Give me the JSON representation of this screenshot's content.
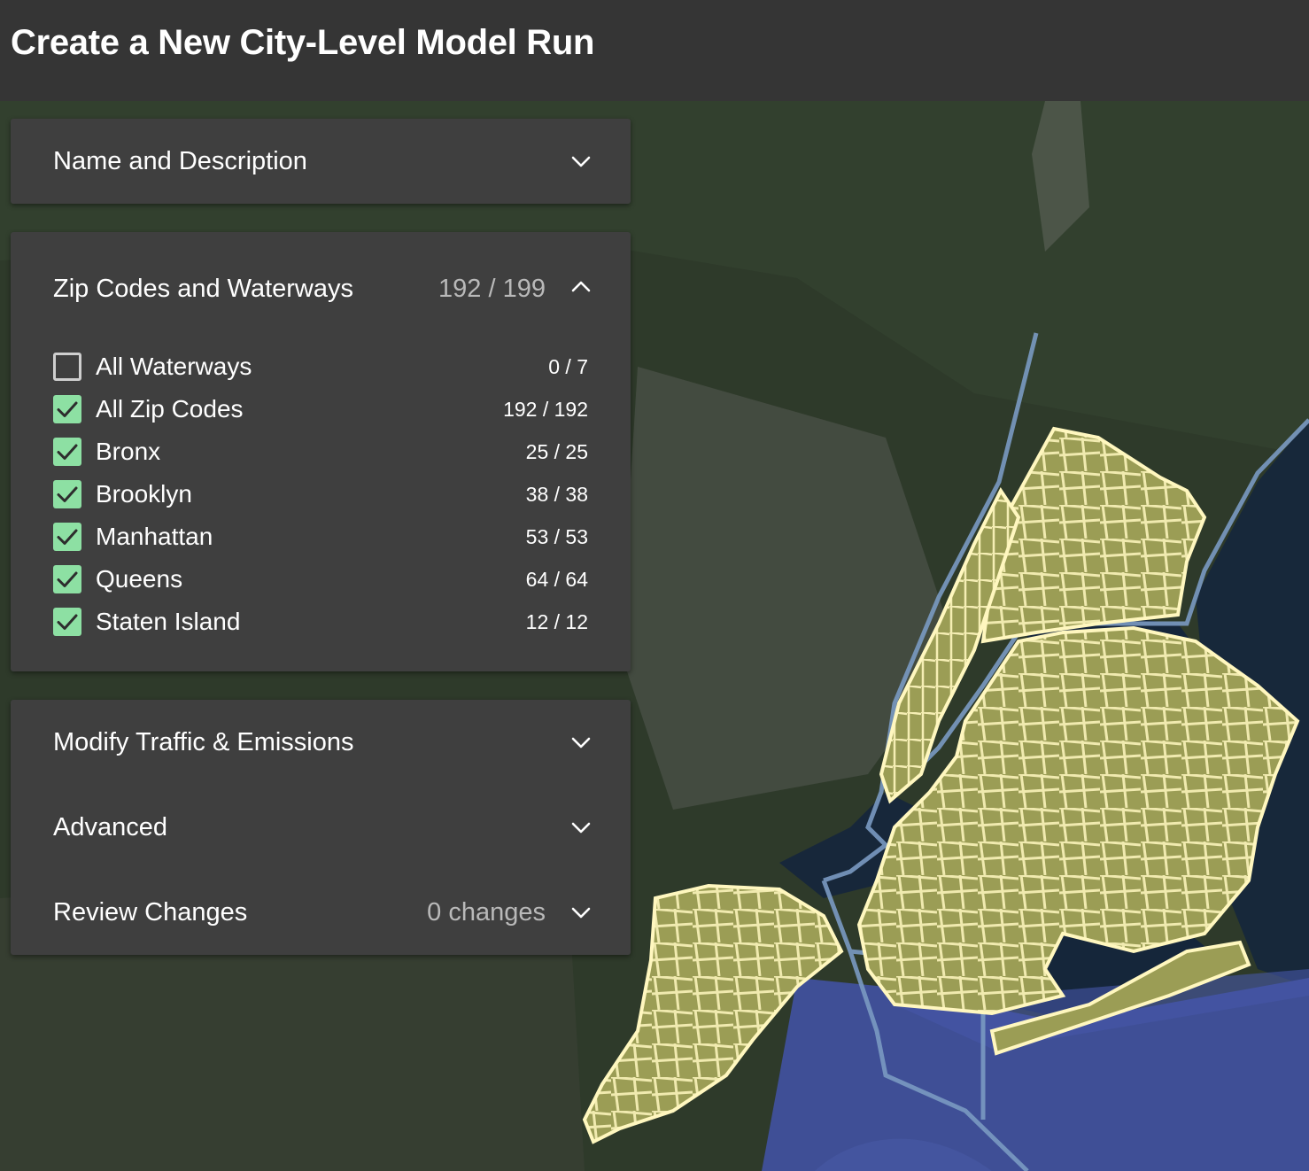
{
  "window": {
    "title": "Create a New City-Level Model Run"
  },
  "colors": {
    "title_bar": "#353535",
    "panel_background": "#3f3f3f",
    "checkbox_checked": "#8de0a3",
    "zip_polygon_fill": "#9b9d55",
    "zip_polygon_stroke": "#fff7bf",
    "waterway_stroke": "#7a9ac2"
  },
  "sections": {
    "name_description": {
      "title": "Name and Description",
      "expanded": false,
      "icon": "chevron-down-icon"
    },
    "zip_waterways": {
      "title": "Zip Codes and Waterways",
      "count": "192 / 199",
      "expanded": true,
      "icon": "chevron-up-icon",
      "items": [
        {
          "label": "All Waterways",
          "count": "0 / 7",
          "checked": false
        },
        {
          "label": "All Zip Codes",
          "count": "192 / 192",
          "checked": true
        },
        {
          "label": "Bronx",
          "count": "25 / 25",
          "checked": true
        },
        {
          "label": "Brooklyn",
          "count": "38 / 38",
          "checked": true
        },
        {
          "label": "Manhattan",
          "count": "53 / 53",
          "checked": true
        },
        {
          "label": "Queens",
          "count": "64 / 64",
          "checked": true
        },
        {
          "label": "Staten Island",
          "count": "12 / 12",
          "checked": true
        }
      ]
    },
    "modify_traffic": {
      "title": "Modify Traffic & Emissions",
      "expanded": false,
      "icon": "chevron-down-icon"
    },
    "advanced": {
      "title": "Advanced",
      "expanded": false,
      "icon": "chevron-down-icon"
    },
    "review_changes": {
      "title": "Review Changes",
      "count": "0 changes",
      "expanded": false,
      "icon": "chevron-down-icon"
    }
  }
}
